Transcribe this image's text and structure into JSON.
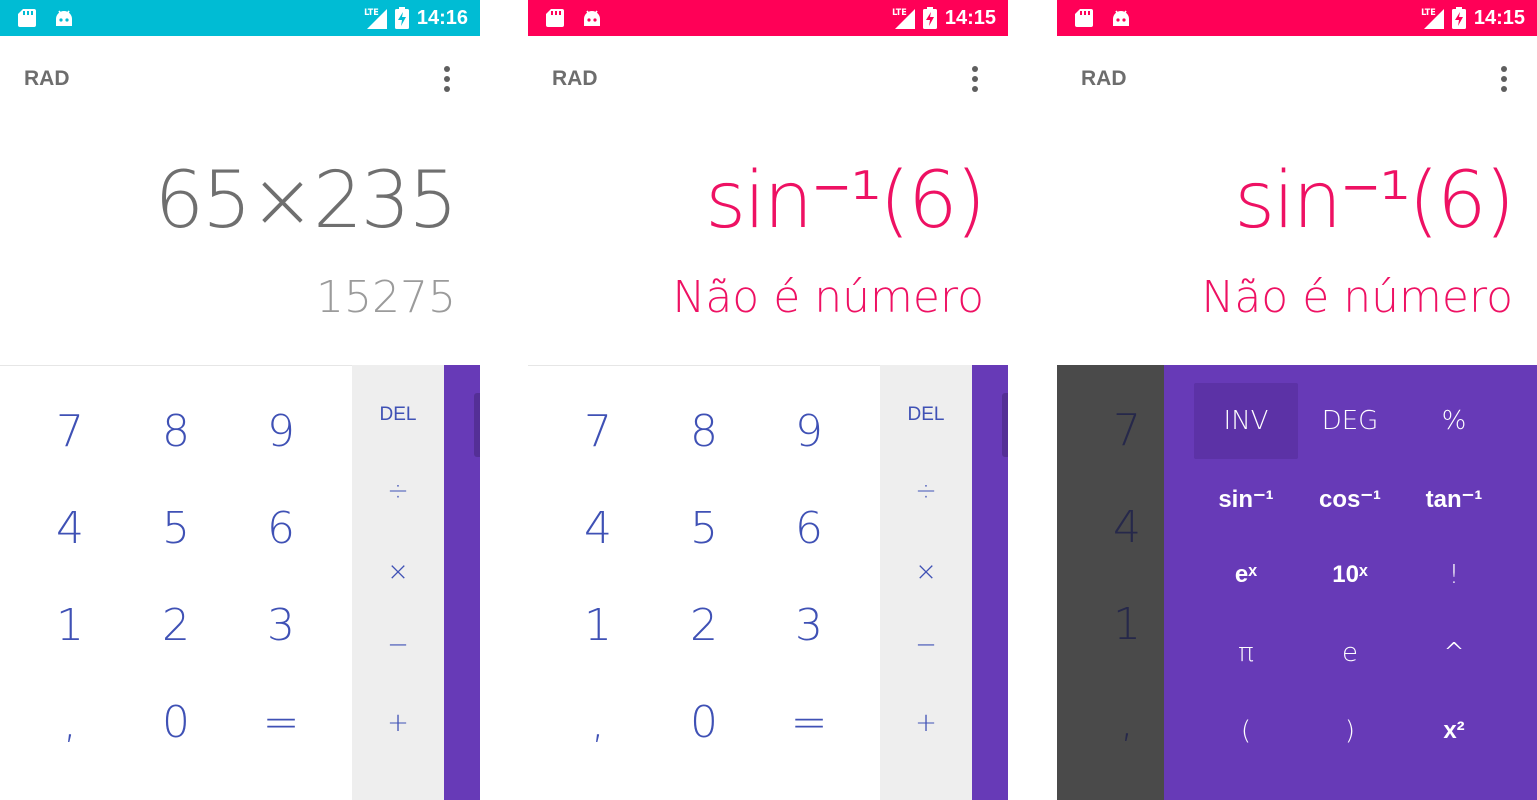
{
  "colors": {
    "status_bar": [
      "#00bcd4",
      "#ff0057",
      "#ff0057"
    ],
    "formula": [
      "#6f6f6f",
      "#ee1163",
      "#ee1163"
    ],
    "result": [
      "#9b9b9b",
      "#ee1163",
      "#ee1163"
    ],
    "digit": "#3f51b5",
    "advanced_pad": "#673ab7",
    "operator_pad": "#eeeeee"
  },
  "phones": [
    {
      "status": {
        "network": "LTE",
        "time": "14:16",
        "icons": [
          "sd-card-icon",
          "android-icon",
          "signal-icon",
          "battery-charging-icon"
        ]
      },
      "toolbar": {
        "mode": "RAD",
        "menu_icon": "overflow-menu-icon"
      },
      "display": {
        "formula": "65×235",
        "result": "15275"
      },
      "numeric_keys": [
        "7",
        "8",
        "9",
        "4",
        "5",
        "6",
        "1",
        "2",
        "3",
        ",",
        "0",
        "="
      ],
      "operator_keys": [
        "DEL",
        "÷",
        "×",
        "−",
        "+"
      ]
    },
    {
      "status": {
        "network": "LTE",
        "time": "14:15",
        "icons": [
          "sd-card-icon",
          "android-icon",
          "signal-icon",
          "battery-charging-icon"
        ]
      },
      "toolbar": {
        "mode": "RAD",
        "menu_icon": "overflow-menu-icon"
      },
      "display": {
        "formula": "sin⁻¹(6)",
        "result": "Não é número"
      },
      "numeric_keys": [
        "7",
        "8",
        "9",
        "4",
        "5",
        "6",
        "1",
        "2",
        "3",
        ",",
        "0",
        "="
      ],
      "operator_keys": [
        "DEL",
        "÷",
        "×",
        "−",
        "+"
      ]
    },
    {
      "status": {
        "network": "LTE",
        "time": "14:15",
        "icons": [
          "sd-card-icon",
          "android-icon",
          "signal-icon",
          "battery-charging-icon"
        ]
      },
      "toolbar": {
        "mode": "RAD",
        "menu_icon": "overflow-menu-icon"
      },
      "display": {
        "formula": "sin⁻¹(6)",
        "result": "Não é número"
      },
      "numeric_keys_visible": [
        "7",
        "4",
        "1",
        ","
      ],
      "advanced_keys": [
        "INV",
        "DEG",
        "%",
        "sin⁻¹",
        "cos⁻¹",
        "tan⁻¹",
        "eˣ",
        "10ˣ",
        "!",
        "π",
        "e",
        "^",
        "(",
        ")",
        "x²"
      ]
    }
  ]
}
